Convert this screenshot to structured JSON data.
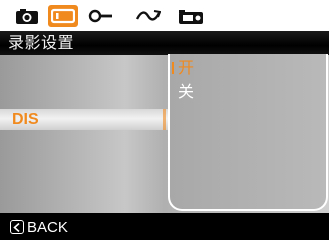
{
  "tabs": [
    {
      "name": "camera",
      "icon": "camera-icon",
      "active": false
    },
    {
      "name": "video",
      "icon": "video-record-icon",
      "active": true
    },
    {
      "name": "setup",
      "icon": "wrench-icon",
      "active": false
    },
    {
      "name": "connect",
      "icon": "connection-icon",
      "active": false
    },
    {
      "name": "playback",
      "icon": "playback-icon",
      "active": false
    }
  ],
  "header": {
    "title": "录影设置"
  },
  "menu": {
    "items": [
      {
        "label": "DIS",
        "selected": true
      }
    ]
  },
  "submenu": {
    "options": [
      {
        "label": "开",
        "selected": true
      },
      {
        "label": "关",
        "selected": false
      }
    ]
  },
  "footer": {
    "back_label": "BACK",
    "back_icon": "chevron-left-icon"
  },
  "colors": {
    "accent": "#f08a1f",
    "tabbar_bg": "#ffffff",
    "titlebar_bg": "#000000"
  }
}
